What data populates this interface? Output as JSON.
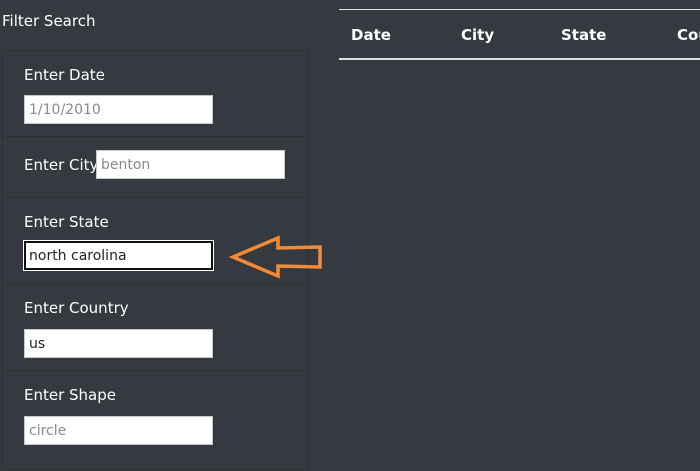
{
  "sidebar": {
    "title": "Filter Search"
  },
  "filters": {
    "date": {
      "label": "Enter Date",
      "value": "",
      "placeholder": "1/10/2010"
    },
    "city": {
      "label": "Enter City",
      "value": "",
      "placeholder": "benton"
    },
    "state": {
      "label": "Enter State",
      "value": "north carolina",
      "placeholder": ""
    },
    "country": {
      "label": "Enter Country",
      "value": "us",
      "placeholder": ""
    },
    "shape": {
      "label": "Enter Shape",
      "value": "",
      "placeholder": "circle"
    }
  },
  "table": {
    "headers": [
      "Date",
      "City",
      "State",
      "Country"
    ]
  },
  "annotation": {
    "icon": "arrow-left-icon",
    "color": "#f58a34"
  },
  "colors": {
    "background": "#343a40",
    "text": "#ffffff",
    "accent": "#f58a34"
  }
}
